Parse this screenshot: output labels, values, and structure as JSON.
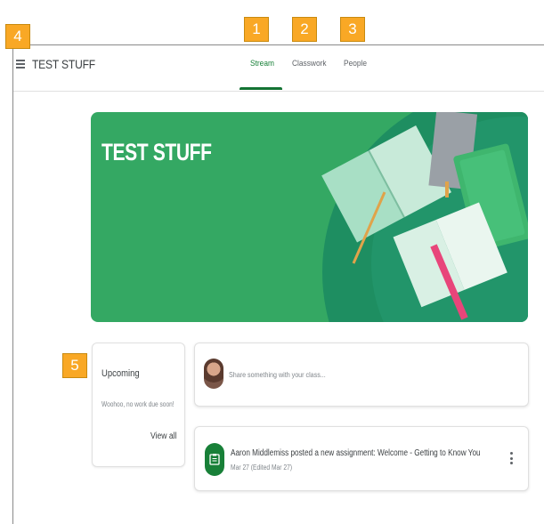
{
  "header": {
    "class_title": "TEST STUFF",
    "tabs": [
      {
        "label": "Stream",
        "active": true
      },
      {
        "label": "Classwork",
        "active": false
      },
      {
        "label": "People",
        "active": false
      }
    ]
  },
  "banner": {
    "title": "TEST STUFF"
  },
  "upcoming": {
    "title": "Upcoming",
    "status": "Woohoo, no work due soon!",
    "view_all": "View all"
  },
  "share": {
    "placeholder": "Share something with your class..."
  },
  "post": {
    "text": "Aaron Middlemiss posted a new assignment: Welcome - Getting to Know You",
    "date": "Mar 27 (Edited Mar 27)"
  },
  "annotations": [
    "1",
    "2",
    "3",
    "4",
    "5"
  ],
  "colors": {
    "accent": "#188038",
    "banner": "#34a863",
    "badge": "#f9a825"
  },
  "icons": [
    "menu-icon",
    "avatar",
    "assignment-icon",
    "more-vert-icon"
  ]
}
